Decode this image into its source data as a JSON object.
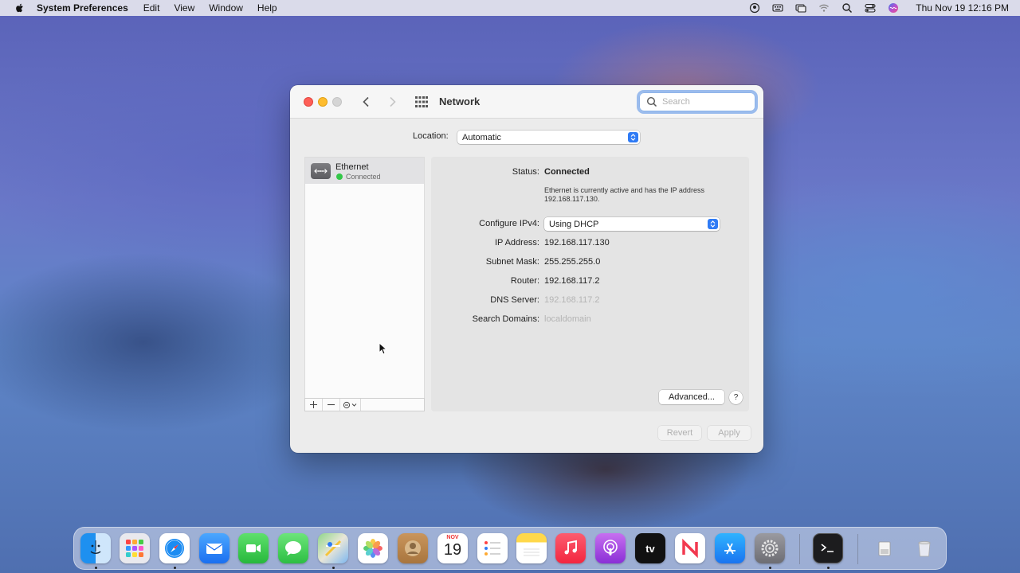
{
  "menubar": {
    "app_name": "System Preferences",
    "menus": [
      "Edit",
      "View",
      "Window",
      "Help"
    ],
    "clock": "Thu Nov 19  12:16 PM",
    "status_icons": [
      "user-icon",
      "keyboard-icon",
      "display-mirroring-icon",
      "wifi-icon",
      "spotlight-search-icon",
      "control-center-icon",
      "siri-icon"
    ]
  },
  "window": {
    "title": "Network",
    "search_placeholder": "Search",
    "location_label": "Location:",
    "location_value": "Automatic",
    "services": [
      {
        "name": "Ethernet",
        "status": "Connected",
        "status_color": "#33c748"
      }
    ],
    "detail": {
      "status_label": "Status:",
      "status_value": "Connected",
      "status_description": "Ethernet is currently active and has the IP address 192.168.117.130.",
      "configure_label": "Configure IPv4:",
      "configure_value": "Using DHCP",
      "ip_label": "IP Address:",
      "ip_value": "192.168.117.130",
      "subnet_label": "Subnet Mask:",
      "subnet_value": "255.255.255.0",
      "router_label": "Router:",
      "router_value": "192.168.117.2",
      "dns_label": "DNS Server:",
      "dns_value": "192.168.117.2",
      "domains_label": "Search Domains:",
      "domains_value": "localdomain"
    },
    "advanced_label": "Advanced...",
    "help_label": "?",
    "revert_label": "Revert",
    "apply_label": "Apply"
  },
  "dock": {
    "calendar_month": "NOV",
    "calendar_day": "19",
    "tv_label": "tv",
    "apps": [
      "Finder",
      "Launchpad",
      "Safari",
      "Mail",
      "FaceTime",
      "Messages",
      "Maps",
      "Photos",
      "Contacts",
      "Calendar",
      "Reminders",
      "Notes",
      "Music",
      "Podcasts",
      "TV",
      "News",
      "App Store",
      "System Preferences",
      "Terminal",
      "Downloads",
      "Trash"
    ]
  },
  "colors": {
    "accent": "#2f7bf5",
    "close": "#fe5f57",
    "minimize": "#febc2e"
  }
}
